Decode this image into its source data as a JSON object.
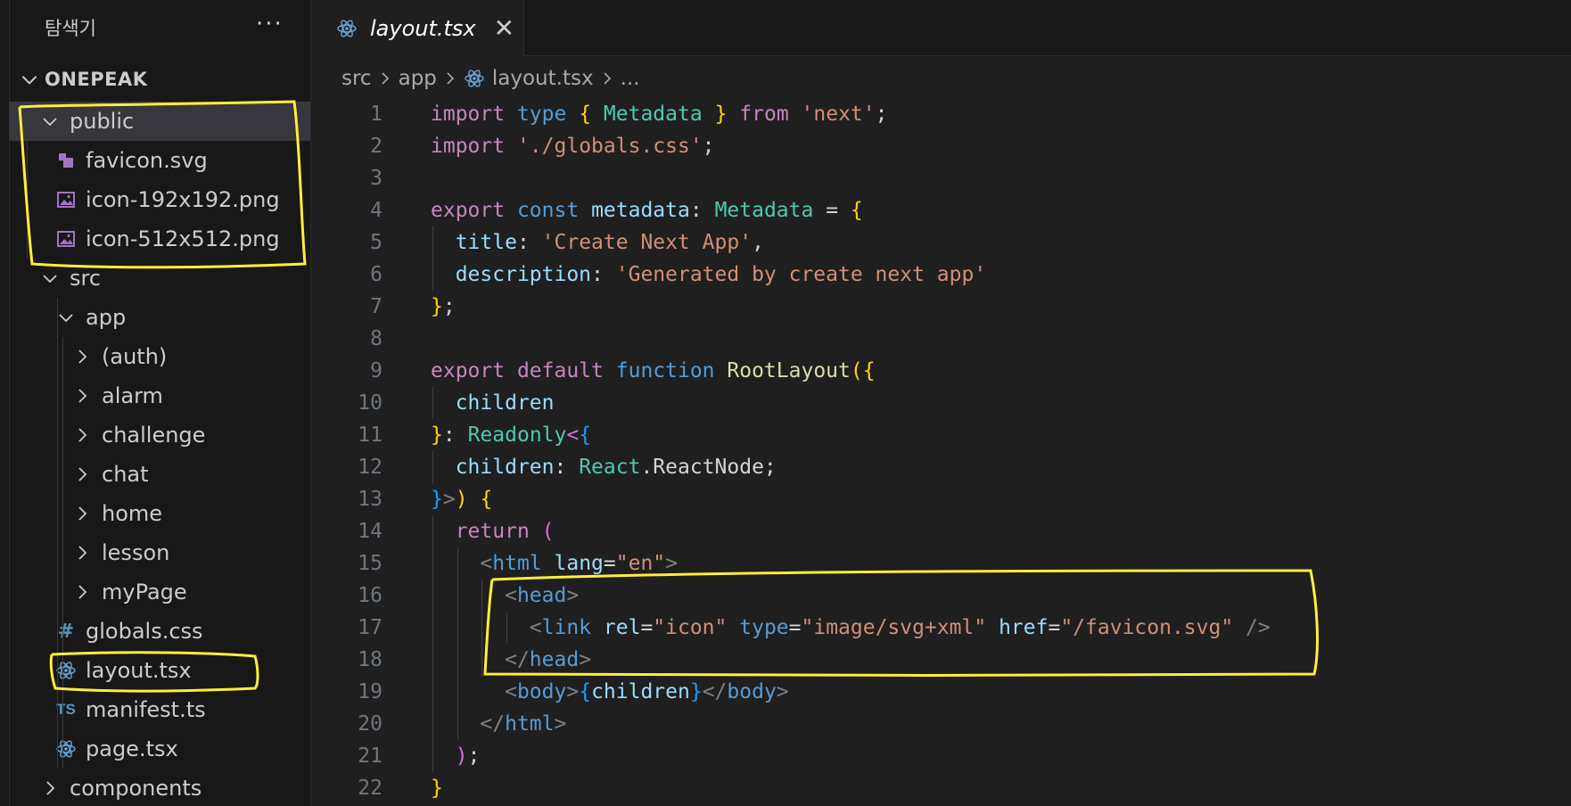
{
  "sidebar": {
    "title": "탐색기",
    "more": "···",
    "project": "ONEPEAK",
    "items": [
      {
        "label": "public",
        "icon": "folder-open"
      },
      {
        "label": "favicon.svg",
        "icon": "svg-file-icon"
      },
      {
        "label": "icon-192x192.png",
        "icon": "image-file-icon"
      },
      {
        "label": "icon-512x512.png",
        "icon": "image-file-icon"
      },
      {
        "label": "src",
        "icon": "folder-open"
      },
      {
        "label": "app",
        "icon": "folder-open"
      },
      {
        "label": "(auth)",
        "icon": "folder-closed"
      },
      {
        "label": "alarm",
        "icon": "folder-closed"
      },
      {
        "label": "challenge",
        "icon": "folder-closed"
      },
      {
        "label": "chat",
        "icon": "folder-closed"
      },
      {
        "label": "home",
        "icon": "folder-closed"
      },
      {
        "label": "lesson",
        "icon": "folder-closed"
      },
      {
        "label": "myPage",
        "icon": "folder-closed"
      },
      {
        "label": "globals.css",
        "icon": "css-hash-icon"
      },
      {
        "label": "layout.tsx",
        "icon": "react-icon"
      },
      {
        "label": "manifest.ts",
        "icon": "ts-icon"
      },
      {
        "label": "page.tsx",
        "icon": "react-icon"
      },
      {
        "label": "components",
        "icon": "folder-closed"
      }
    ]
  },
  "tab": {
    "label": "layout.tsx",
    "close": "✕"
  },
  "breadcrumb": {
    "parts": [
      "src",
      "app",
      "layout.tsx",
      "..."
    ]
  },
  "code": {
    "line_numbers": [
      "1",
      "2",
      "3",
      "4",
      "5",
      "6",
      "7",
      "8",
      "9",
      "10",
      "11",
      "12",
      "13",
      "14",
      "15",
      "16",
      "17",
      "18",
      "19",
      "20",
      "21",
      "22"
    ],
    "lines": [
      "import type { Metadata } from 'next';",
      "import './globals.css';",
      "",
      "export const metadata: Metadata = {",
      "  title: 'Create Next App',",
      "  description: 'Generated by create next app'",
      "};",
      "",
      "export default function RootLayout({",
      "  children",
      "}: Readonly<{",
      "  children: React.ReactNode;",
      "}>) {",
      "  return (",
      "    <html lang=\"en\">",
      "      <head>",
      "        <link rel=\"icon\" type=\"image/svg+xml\" href=\"/favicon.svg\" />",
      "      </head>",
      "      <body>{children}</body>",
      "    </html>",
      "  );",
      "}"
    ]
  },
  "colors": {
    "keyword": "#c586c0",
    "keyword_blue": "#569cd6",
    "type": "#4ec9b0",
    "variable": "#9cdcfe",
    "string": "#ce9178",
    "function": "#dcdcaa",
    "annotation": "#ffef3a"
  }
}
